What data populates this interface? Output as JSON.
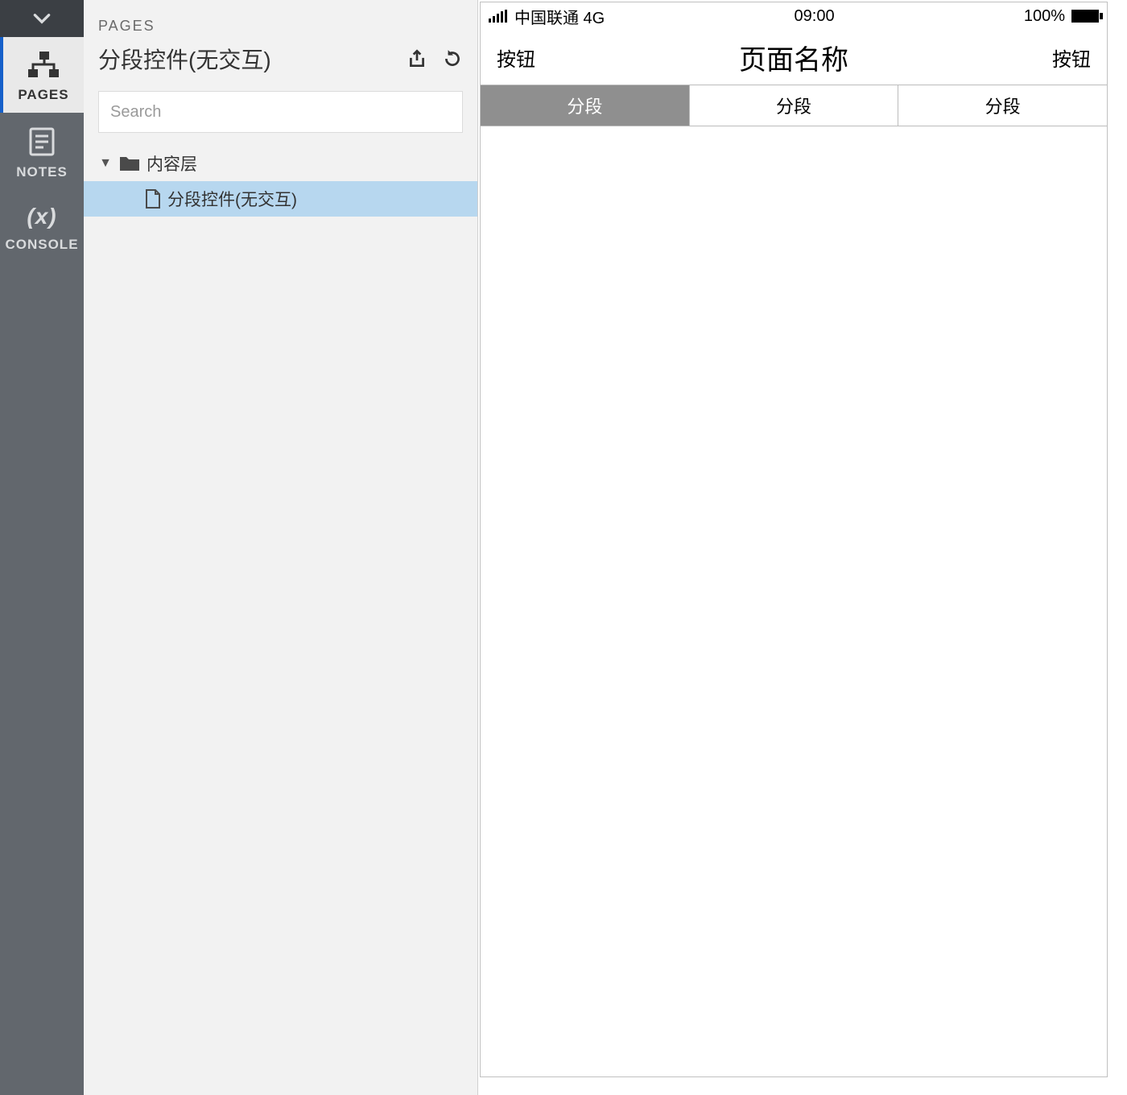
{
  "rail": {
    "tabs": [
      {
        "id": "pages",
        "label": "PAGES",
        "active": true
      },
      {
        "id": "notes",
        "label": "NOTES",
        "active": false
      },
      {
        "id": "console",
        "label": "CONSOLE",
        "active": false
      }
    ]
  },
  "panel": {
    "kicker": "PAGES",
    "title": "分段控件(无交互)",
    "search_placeholder": "Search",
    "tree": {
      "folder_label": "内容层",
      "page_label": "分段控件(无交互)"
    }
  },
  "device": {
    "status": {
      "carrier": "中国联通 4G",
      "time": "09:00",
      "battery_pct": "100%"
    },
    "navbar": {
      "left_button": "按钮",
      "title": "页面名称",
      "right_button": "按钮"
    },
    "segments": [
      "分段",
      "分段",
      "分段"
    ],
    "active_segment_index": 0
  }
}
